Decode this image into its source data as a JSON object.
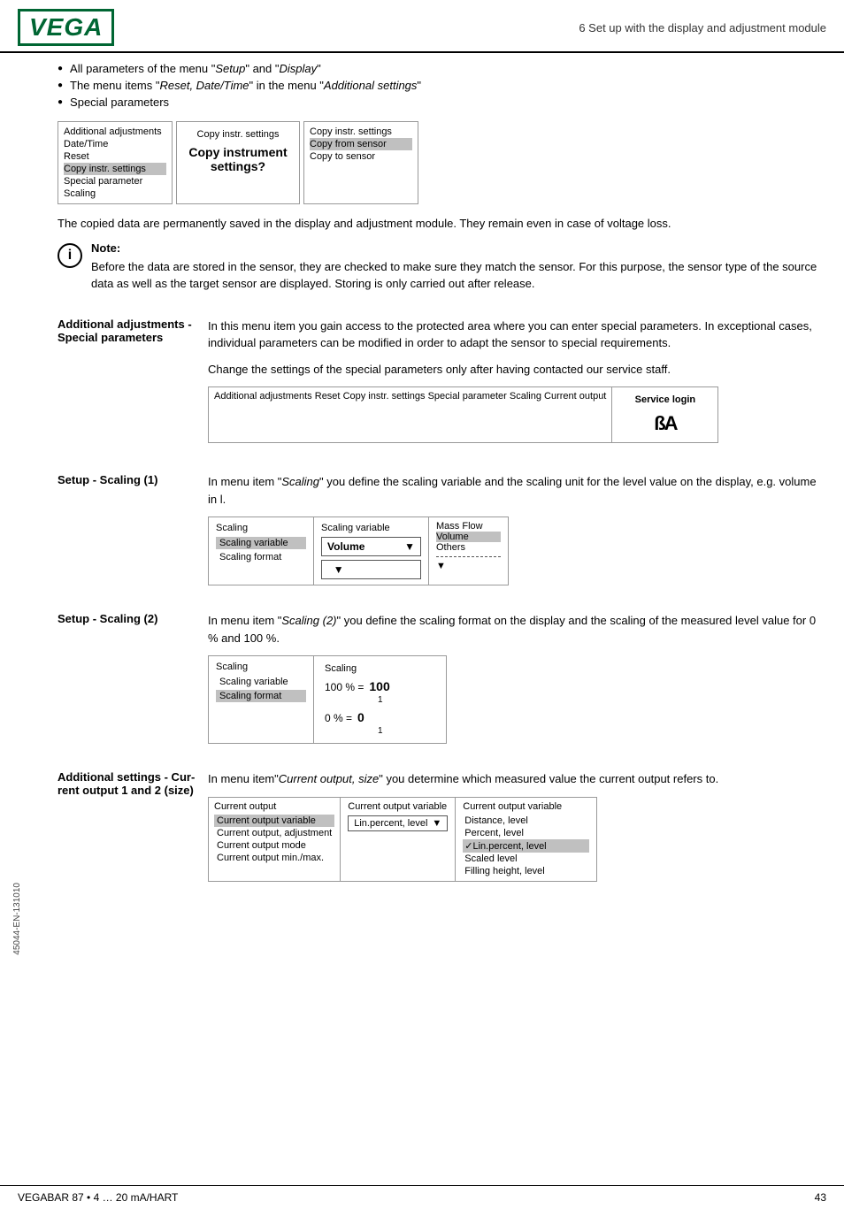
{
  "header": {
    "logo": "VEGA",
    "title": "6 Set up with the display and adjustment module"
  },
  "bullets": {
    "items": [
      "All parameters of the menu \"Setup\" and \"Display\"",
      "The menu items \"Reset, Date/Time\" in the menu \"Additional settings\"",
      "Special parameters"
    ]
  },
  "copy_diagram": {
    "left_box": {
      "title": "Additional adjustments",
      "items": [
        "Date/Time",
        "Reset",
        "Copy instr. settings",
        "Special parameter",
        "Scaling"
      ],
      "highlighted": "Copy instr. settings"
    },
    "center_box": {
      "label": "Copy instr. settings",
      "big_text": "Copy instrument",
      "big_text2": "settings?"
    },
    "right_box": {
      "label": "Copy instr. settings",
      "items": [
        "Copy from sensor",
        "Copy to sensor"
      ],
      "highlighted": "Copy from sensor"
    }
  },
  "copied_data_text": "The copied data are permanently saved in the display and adjustment module. They remain even in case of voltage loss.",
  "note": {
    "title": "Note:",
    "text": "Before the data are stored in the sensor, they are checked to make sure they match the sensor. For this purpose, the sensor type of the source data as well as the target sensor are displayed. Storing is only carried out after release."
  },
  "additional_adjustments": {
    "label_line1": "Additional adjustments -",
    "label_line2": "Special parameters",
    "paragraph1": "In this menu item you gain access to the protected area where you can enter special parameters. In exceptional cases, individual parameters can be modified in order to adapt the sensor to special requirements.",
    "paragraph2": "Change the settings of the special parameters only after having contacted our service staff.",
    "diagram": {
      "left_box": {
        "items": [
          "Additional adjustments",
          "Reset",
          "Copy instr. settings",
          "Special parameter",
          "Scaling",
          "Current output"
        ],
        "highlighted": "Special parameter"
      },
      "right_box": {
        "label": "Service login",
        "icon": "ßA"
      }
    }
  },
  "setup_scaling1": {
    "label": "Setup - Scaling (1)",
    "paragraph": "In menu item \"Scaling\" you define the scaling variable and the scaling unit for the level value on the display, e.g. volume in l.",
    "diagram": {
      "left_box": {
        "title": "Scaling",
        "items": [
          "Scaling variable",
          "Scaling format"
        ],
        "highlighted": "Scaling variable"
      },
      "center_box": {
        "title": "Scaling variable",
        "dropdown_value": "Volume",
        "dropdown2": ""
      },
      "right_box": {
        "items": [
          "Mass",
          "Flow",
          "Volume",
          "Others"
        ],
        "highlighted": "Volume",
        "has_divider": true
      }
    }
  },
  "setup_scaling2": {
    "label": "Setup - Scaling (2)",
    "paragraph": "In menu item \"Scaling (2)\" you define the scaling format on the display and the scaling of the measured level value for 0 % and 100 %.",
    "diagram": {
      "left_box": {
        "title": "Scaling",
        "items": [
          "Scaling variable",
          "Scaling format"
        ],
        "highlighted": "Scaling format"
      },
      "right_box": {
        "title": "Scaling",
        "row1_label": "100 % =",
        "row1_val": "100",
        "row1_sub": "1",
        "row2_label": "0 % =",
        "row2_val": "0",
        "row2_sub": "1"
      }
    }
  },
  "additional_settings_current": {
    "label_line1": "Additional settings - Cur-",
    "label_line2": "rent output 1 and 2 (size)",
    "paragraph": "In menu item\"Current output, size\" you determine which measured value the current output refers to.",
    "diagram": {
      "left_box": {
        "title": "Current output",
        "items": [
          "Current output variable",
          "Current output, adjustment",
          "Current output mode",
          "Current output min./max."
        ],
        "highlighted": "Current output variable"
      },
      "center_box": {
        "title": "Current output variable",
        "dropdown": "Lin.percent, level"
      },
      "right_box": {
        "title": "Current output variable",
        "items": [
          "Distance, level",
          "Percent, level",
          "Lin.percent, level",
          "Scaled level",
          "Filling height, level"
        ],
        "highlighted": "Lin.percent, level"
      }
    }
  },
  "footer": {
    "left": "VEGABAR 87 • 4 … 20 mA/HART",
    "right": "43"
  },
  "sidebar": {
    "doc_id": "45044-EN-131010"
  }
}
